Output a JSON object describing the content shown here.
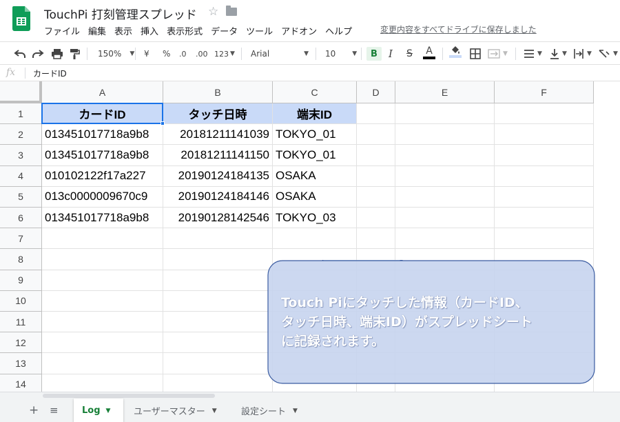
{
  "app": {
    "title": "TouchPi 打刻管理スプレッド",
    "star_icon": "☆",
    "save_status": "変更内容をすべてドライブに保存しました",
    "brand_color": "#0f9d58"
  },
  "menu": [
    "ファイル",
    "編集",
    "表示",
    "挿入",
    "表示形式",
    "データ",
    "ツール",
    "アドオン",
    "ヘルプ"
  ],
  "toolbar": {
    "zoom": "150%",
    "currency": "¥",
    "percent": "%",
    "decrease_decimal": ".0",
    "increase_decimal": ".00",
    "more_formats": "123",
    "font": "Arial",
    "font_size": "10",
    "bold": "B",
    "italic": "I",
    "strikethrough": "S",
    "text_color": "A"
  },
  "formula_bar": {
    "fx": "fx",
    "value": "カードID"
  },
  "grid": {
    "columns": [
      "A",
      "B",
      "C",
      "D",
      "E",
      "F"
    ],
    "rows": [
      "1",
      "2",
      "3",
      "4",
      "5",
      "6",
      "7",
      "8",
      "9",
      "10",
      "11",
      "12",
      "13",
      "14"
    ],
    "header": [
      "カードID",
      "タッチ日時",
      "端末ID"
    ],
    "data": [
      [
        "013451017718a9b8",
        "20181211141039",
        "TOKYO_01"
      ],
      [
        "013451017718a9b8",
        "20181211141150",
        "TOKYO_01"
      ],
      [
        "010102122f17a227",
        "20190124184135",
        "OSAKA"
      ],
      [
        "013c0000009670c9",
        "20190124184146",
        "OSAKA"
      ],
      [
        "013451017718a9b8",
        "20190128142546",
        "TOKYO_03"
      ]
    ],
    "header_fill": "#c9daf8",
    "selection_color": "#1a73e8"
  },
  "callout": {
    "lines": [
      "Touch Piにタッチした情報（カードID、",
      "タッチ日時、端末ID）がスプレッドシート",
      "に記録されます。"
    ],
    "fill": "#c5d3ee",
    "stroke": "#3a5ba0"
  },
  "tabs": [
    {
      "label": "Log",
      "active": true
    },
    {
      "label": "ユーザーマスター",
      "active": false
    },
    {
      "label": "設定シート",
      "active": false
    }
  ],
  "tab_controls": {
    "add": "+",
    "list": "≡"
  }
}
